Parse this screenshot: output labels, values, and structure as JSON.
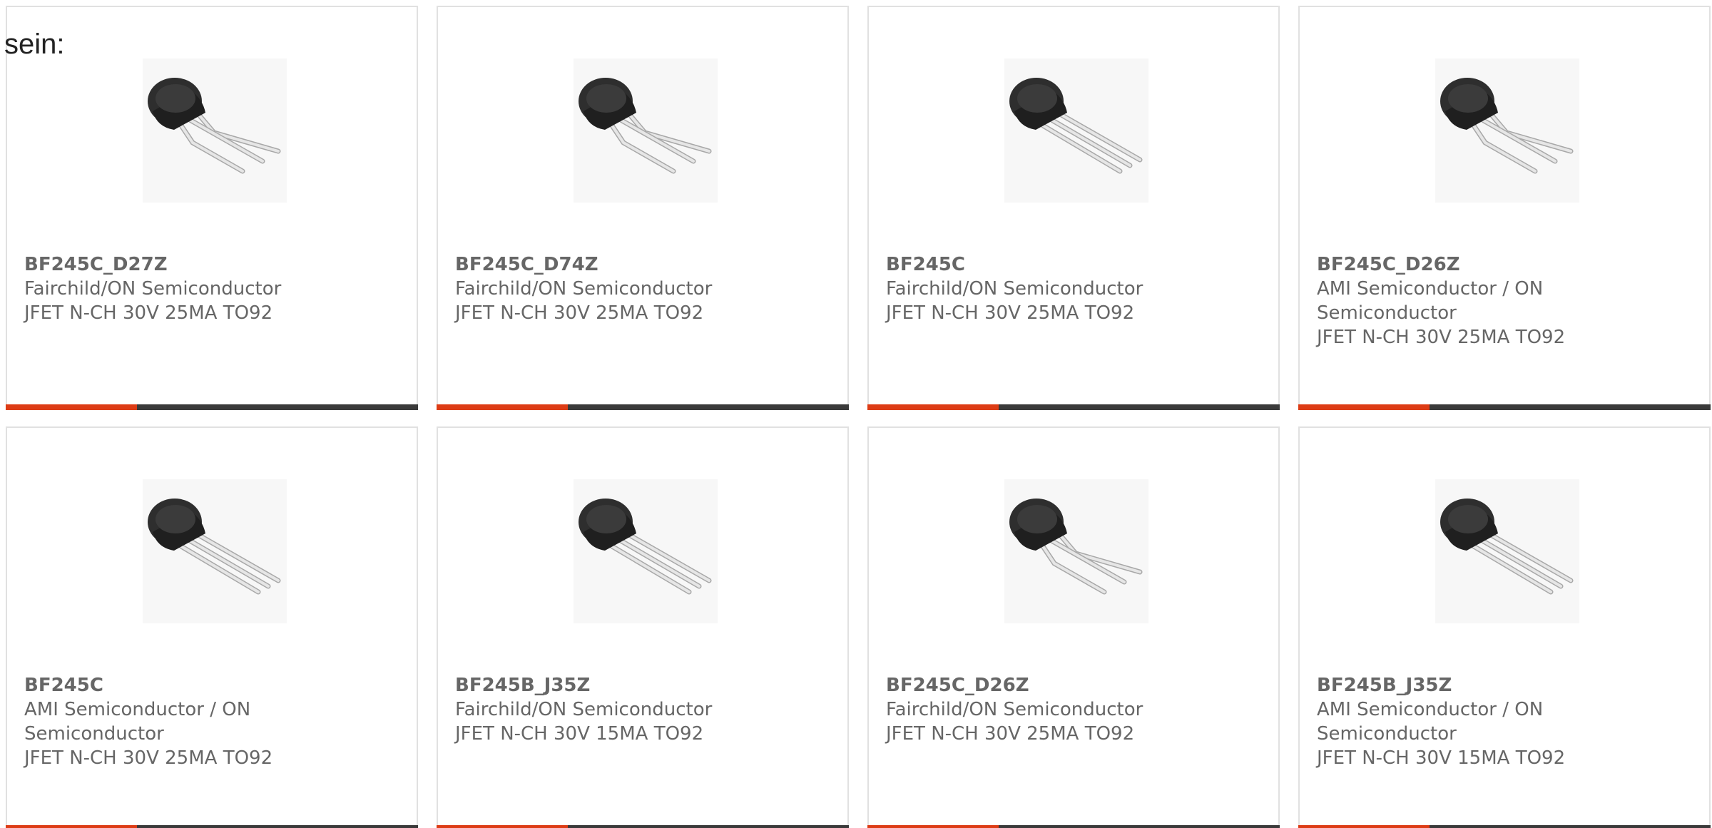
{
  "intro_text": "sein:",
  "colors": {
    "accent": "#dd3c15",
    "bar": "#3a3a3a",
    "text": "#666666",
    "border": "#e1e1e1"
  },
  "products": [
    {
      "part": "BF245C_D27Z",
      "maker": "Fairchild/ON Semiconductor",
      "desc": "JFET N-CH 30V 25MA TO92",
      "image_icon": "to92-transistor-bent-leads-icon"
    },
    {
      "part": "BF245C_D74Z",
      "maker": "Fairchild/ON Semiconductor",
      "desc": "JFET N-CH 30V 25MA TO92",
      "image_icon": "to92-transistor-bent-leads-icon"
    },
    {
      "part": "BF245C",
      "maker": "Fairchild/ON Semiconductor",
      "desc": "JFET N-CH 30V 25MA TO92",
      "image_icon": "to92-transistor-straight-leads-icon"
    },
    {
      "part": "BF245C_D26Z",
      "maker": "AMI Semiconductor / ON Semiconductor",
      "desc": "JFET N-CH 30V 25MA TO92",
      "image_icon": "to92-transistor-bent-leads-icon"
    },
    {
      "part": "BF245C",
      "maker": "AMI Semiconductor / ON Semiconductor",
      "desc": "JFET N-CH 30V 25MA TO92",
      "image_icon": "to92-transistor-straight-leads-icon"
    },
    {
      "part": "BF245B_J35Z",
      "maker": "Fairchild/ON Semiconductor",
      "desc": "JFET N-CH 30V 15MA TO92",
      "image_icon": "to92-transistor-straight-leads-icon"
    },
    {
      "part": "BF245C_D26Z",
      "maker": "Fairchild/ON Semiconductor",
      "desc": "JFET N-CH 30V 25MA TO92",
      "image_icon": "to92-transistor-bent-leads-icon"
    },
    {
      "part": "BF245B_J35Z",
      "maker": "AMI Semiconductor / ON Semiconductor",
      "desc": "JFET N-CH 30V 15MA TO92",
      "image_icon": "to92-transistor-straight-leads-icon"
    }
  ]
}
